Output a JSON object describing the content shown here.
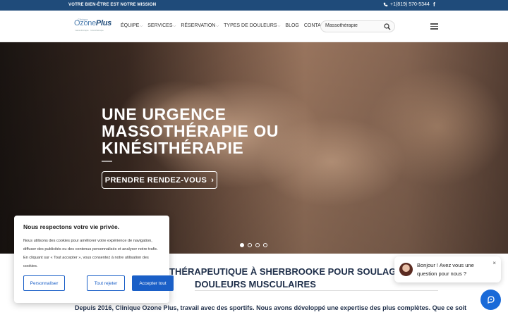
{
  "topbar": {
    "mission": "VOTRE BIEN-ÊTRE EST NOTRE MISSION",
    "phone": "+1(819) 570-5344",
    "facebook": "f"
  },
  "logo": {
    "line1": "Clinique",
    "brand_a": "Ozone",
    "brand_b": "Plus",
    "tagline": "massothérapie · kinésithérapie"
  },
  "nav": {
    "items": [
      {
        "label": "ÉQUIPE",
        "dropdown": true
      },
      {
        "label": "SERVICES",
        "dropdown": true
      },
      {
        "label": "RÉSERVATION",
        "dropdown": true
      },
      {
        "label": "TYPES DE DOULEURS",
        "dropdown": true
      },
      {
        "label": "BLOG",
        "dropdown": false
      },
      {
        "label": "CONTACT",
        "dropdown": false
      }
    ],
    "chevron": "⌵"
  },
  "search": {
    "value": "Massothérapie"
  },
  "hero": {
    "line1": "UNE URGENCE",
    "line2": "MASSOTHÉRAPIE OU",
    "line3": "KINÉSITHÉRAPIE",
    "cta": "PRENDRE RENDEZ-VOUS",
    "cta_arrow": "›",
    "slides_total": 4,
    "slide_active": 1
  },
  "section": {
    "title_line1": "THÉRAPEUTIQUE À SHERBROOKE POUR SOULAGE",
    "title_line2": "DOULEURS MUSCULAIRES",
    "intro": "Depuis 2016, Clinique Ozone Plus, travail avec des sportifs. Nous avons développé une expertise des plus complètes. Que ce soit"
  },
  "cookie": {
    "title": "Nous respectons votre vie privée.",
    "body": "Nous utilisons des cookies pour améliorer votre expérience de navigation, diffuser des publicités ou des contenus personnalisés et analyser notre trafic. En cliquant sur « Tout accepter », vous consentez à notre utilisation des cookies.",
    "btn_customize": "Personnaliser",
    "btn_reject": "Tout rejeter",
    "btn_accept": "Accepter tout"
  },
  "chat": {
    "message": "Bonjour ! Avez vous une question pour nous ?",
    "close": "×"
  },
  "colors": {
    "topbar": "#1f4b7a",
    "accent": "#1a5fc7",
    "chat": "#1a6ad8",
    "heading": "#1f2f4a"
  }
}
